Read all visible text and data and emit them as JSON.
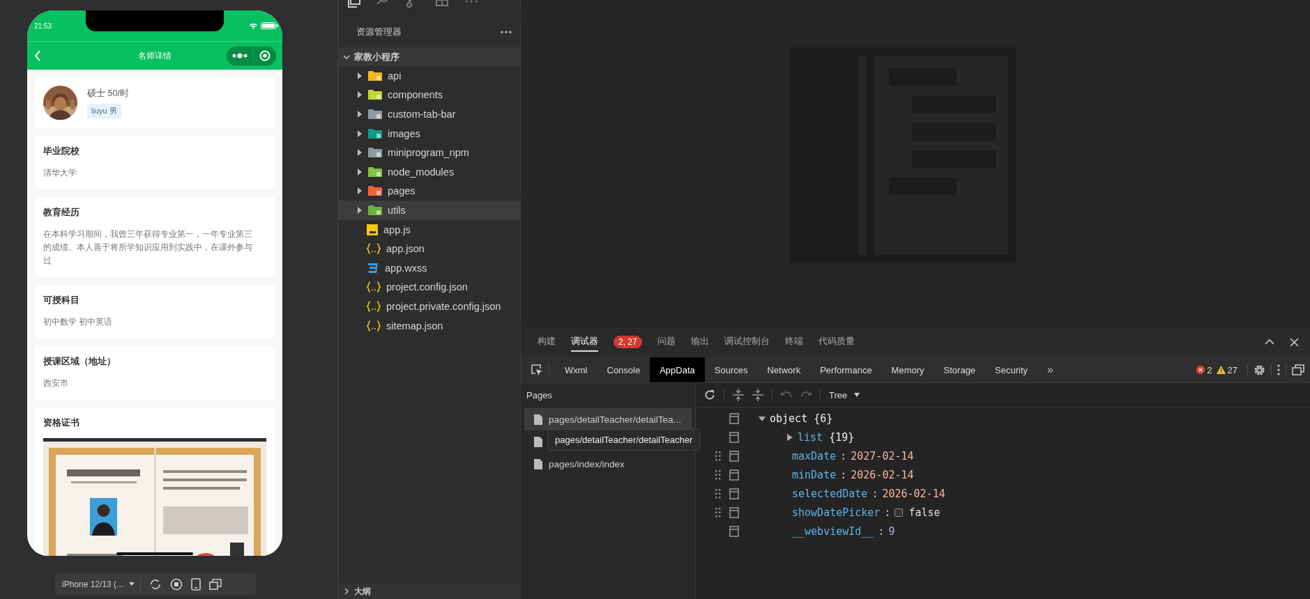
{
  "simulator": {
    "time": "21:53",
    "title": "名师详情",
    "profile": {
      "summary": "硕士 50/时",
      "tag": "liuyu 男"
    },
    "sections": [
      {
        "kind": "text",
        "title": "毕业院校",
        "text": "清华大学"
      },
      {
        "kind": "text",
        "title": "教育经历",
        "text": "在本科学习期间，我曾三年获得专业第一，一年专业第三的成绩。本人善于将所学知识应用到实践中，在课外参与过"
      },
      {
        "kind": "text",
        "title": "可授科目",
        "text": "初中数学 初中英语"
      },
      {
        "kind": "text",
        "title": "授课区域（地址）",
        "text": "西安市"
      },
      {
        "kind": "picture",
        "title": "资格证书"
      }
    ],
    "device": "iPhone 12/13 (..."
  },
  "explorer": {
    "title": "资源管理器",
    "project": {
      "name": "家教小程序",
      "expanded": true
    },
    "items": [
      {
        "kind": "folder",
        "name": "api",
        "color": "#f5b71f",
        "expanded": false,
        "selected": false
      },
      {
        "kind": "folder",
        "name": "components",
        "color": "#c3d633",
        "expanded": false,
        "selected": false
      },
      {
        "kind": "folder",
        "name": "custom-tab-bar",
        "color": "#8c9ba5",
        "expanded": false,
        "selected": false
      },
      {
        "kind": "folder",
        "name": "images",
        "color": "#109a88",
        "expanded": false,
        "selected": false
      },
      {
        "kind": "folder",
        "name": "miniprogram_npm",
        "color": "#8c9ba5",
        "expanded": false,
        "selected": false
      },
      {
        "kind": "folder",
        "name": "node_modules",
        "color": "#86bf45",
        "expanded": false,
        "selected": false
      },
      {
        "kind": "folder",
        "name": "pages",
        "color": "#f4633a",
        "expanded": false,
        "selected": false
      },
      {
        "kind": "folder",
        "name": "utils",
        "color": "#6ab23e",
        "expanded": false,
        "selected": true
      },
      {
        "kind": "js",
        "name": "app.js",
        "selected": false
      },
      {
        "kind": "json",
        "name": "app.json",
        "selected": false
      },
      {
        "kind": "css",
        "name": "app.wxss",
        "selected": false
      },
      {
        "kind": "json",
        "name": "project.config.json",
        "selected": false
      },
      {
        "kind": "json",
        "name": "project.private.config.json",
        "selected": false
      },
      {
        "kind": "json",
        "name": "sitemap.json",
        "selected": false
      }
    ],
    "outline": {
      "label": "大纲",
      "expanded": false
    }
  },
  "devtools": {
    "tabs": [
      {
        "label": "构建",
        "selected": false
      },
      {
        "label": "调试器",
        "selected": true,
        "badge": "2, 27"
      },
      {
        "label": "问题",
        "selected": false
      },
      {
        "label": "输出",
        "selected": false
      },
      {
        "label": "调试控制台",
        "selected": false
      },
      {
        "label": "终端",
        "selected": false
      },
      {
        "label": "代码质量",
        "selected": false
      }
    ],
    "panels": [
      {
        "label": "Wxml",
        "selected": false
      },
      {
        "label": "Console",
        "selected": false
      },
      {
        "label": "AppData",
        "selected": true
      },
      {
        "label": "Sources",
        "selected": false
      },
      {
        "label": "Network",
        "selected": false
      },
      {
        "label": "Performance",
        "selected": false
      },
      {
        "label": "Memory",
        "selected": false
      },
      {
        "label": "Storage",
        "selected": false
      },
      {
        "label": "Security",
        "selected": false
      }
    ],
    "more": "»",
    "errors": "2",
    "warnings": "27",
    "pages": {
      "title": "Pages",
      "items": [
        {
          "label": "pages/detailTeacher/detailTea...",
          "selected": true
        },
        {
          "selected": false
        },
        {
          "label": "pages/index/index",
          "selected": false
        }
      ],
      "tooltip": "pages/detailTeacher/detailTeacher"
    },
    "view": "Tree",
    "separator": ":",
    "tree": {
      "key": "object",
      "summary": "{6}",
      "expanded": true,
      "children": [
        {
          "kind": "object",
          "key": "list",
          "summary": "{19}",
          "expanded": false,
          "editable": false
        },
        {
          "kind": "string",
          "key": "maxDate",
          "value": "2027-02-14",
          "editable": true
        },
        {
          "kind": "string",
          "key": "minDate",
          "value": "2026-02-14",
          "editable": true
        },
        {
          "kind": "string",
          "key": "selectedDate",
          "value": "2026-02-14",
          "editable": true
        },
        {
          "kind": "boolean",
          "key": "showDatePicker",
          "value": "false",
          "checked": false,
          "editable": true
        },
        {
          "kind": "number",
          "key": "__webviewId__",
          "value": "9",
          "editable": false
        }
      ]
    }
  }
}
